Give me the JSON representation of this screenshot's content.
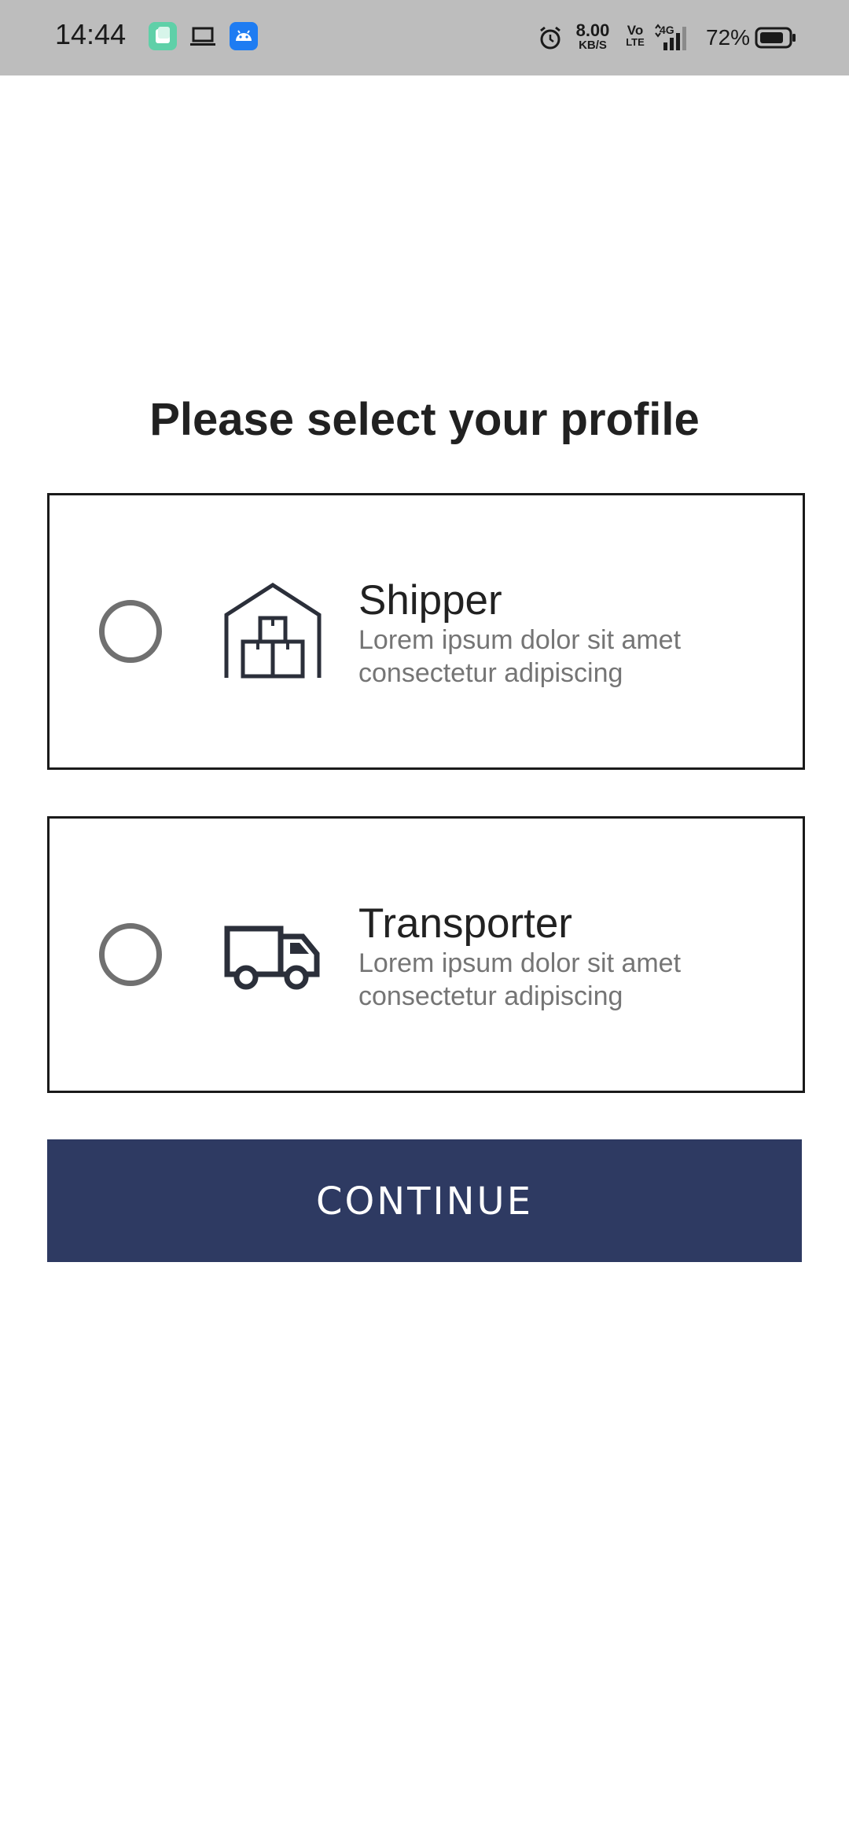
{
  "status_bar": {
    "time": "14:44",
    "network_speed_value": "8.00",
    "network_speed_unit": "KB/S",
    "volte_top": "Vo",
    "volte_bottom": "LTE",
    "network_type": "4G",
    "battery_percent": "72%",
    "app_icons": [
      "notes-app-icon",
      "laptop-icon",
      "android-debug-icon"
    ]
  },
  "page": {
    "title": "Please select your profile"
  },
  "profiles": [
    {
      "title": "Shipper",
      "description": "Lorem ipsum dolor sit amet consectetur adipiscing",
      "icon": "warehouse-icon",
      "selected": false
    },
    {
      "title": "Transporter",
      "description": "Lorem ipsum dolor sit amet consectetur adipiscing",
      "icon": "truck-icon",
      "selected": false
    }
  ],
  "actions": {
    "continue_label": "CONTINUE"
  },
  "colors": {
    "status_bar_bg": "#bdbdbd",
    "primary_button": "#2e3a62",
    "radio_border": "#707070",
    "description_text": "#757575"
  }
}
